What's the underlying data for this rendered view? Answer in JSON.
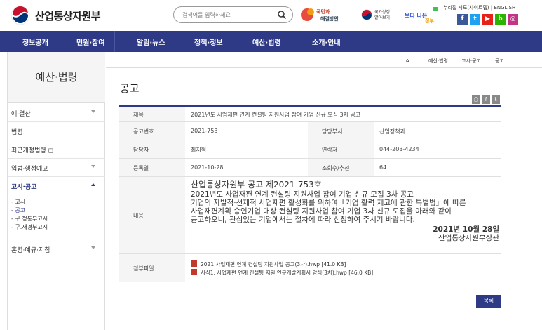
{
  "header": {
    "site_name": "산업통상자원부",
    "search_placeholder": "검색어를 입력하세요",
    "banner1": "국민과 함께하는 해결방안",
    "banner2": "국가상징 알아보기",
    "banner3": "보다 나은 정부",
    "toplinks": "누리집 지도(사이트맵) | ENGLISH",
    "sns": [
      "f",
      "t",
      "▶",
      "b",
      "◎"
    ]
  },
  "nav": [
    "정보공개",
    "민원·참여",
    "알림·뉴스",
    "정책·정보",
    "예산·법령",
    "소개·안내"
  ],
  "sidebar": {
    "title": "예산·법령",
    "items": [
      {
        "label": "예·결산",
        "chevron": "down"
      },
      {
        "label": "법령",
        "chevron": ""
      },
      {
        "label": "최근개정법령 ◻",
        "chevron": ""
      },
      {
        "label": "입법·행정예고",
        "chevron": "down"
      },
      {
        "label": "고시·공고",
        "chevron": "up"
      },
      {
        "label": "훈령·예규·지침",
        "chevron": "down"
      }
    ],
    "subitems": [
      "- 고시",
      "- 공고",
      "- 구.정통부고시",
      "- 구.재경부고시"
    ]
  },
  "breadcrumb": [
    "⌂",
    "예산·법령",
    "고시·공고",
    "공고"
  ],
  "page_title": "공고",
  "tools": [
    "⎙",
    "f",
    "t"
  ],
  "table": {
    "title_label": "제목",
    "title_value": "2021년도 사업재편 연계 컨설팅 지원사업 참여 기업 신규 모집 3차 공고",
    "no_label": "공고번호",
    "no_value": "2021-753",
    "dept_label": "담당부서",
    "dept_value": "산업정책과",
    "person_label": "담당자",
    "person_value": "최지혁",
    "contact_label": "연락처",
    "contact_value": "044-203-4234",
    "date_label": "등록일",
    "date_value": "2021-10-28",
    "views_label": "조회수/추천",
    "views_value": "64",
    "content_label": "내용",
    "content_lines": [
      "산업통상자원부 공고 제2021-753호",
      "2021년도 사업재편 연계 컨설팅 지원사업 참여 기업 신규 모집 3차 공고",
      "기업의 자발적·선제적 사업재편 활성화를 위하여「기업 활력 제고에 관한 특별법」에 따른",
      "사업재편계획 승인기업 대상 컨설팅 지원사업 참여 기업 3차 신규 모집을 아래와 같이",
      "공고하오니, 관심있는 기업에서는 절차에 따라 신청하여 주시기 바랍니다."
    ],
    "content_date": "2021년 10월 28일",
    "content_signer": "산업통상자원부장관",
    "files_label": "첨부파일",
    "files": [
      "2021 사업재편 연계 컨설팅 지원사업 공고(3차).hwp [41.0 KB]",
      "서식1. 사업재편 연계 컨설팅 지원 연구개발계획서 양식(3차).hwp [46.0 KB]"
    ]
  },
  "list_button": "목록"
}
